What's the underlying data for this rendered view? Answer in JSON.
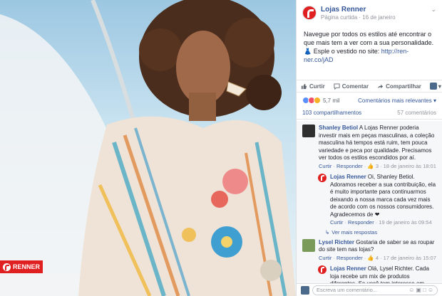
{
  "photo": {
    "badge_text": "RENNER"
  },
  "post": {
    "page_name": "Lojas Renner",
    "page_type": "Página curtida",
    "date": "16 de janeiro",
    "text": "Navegue por todos os estilos até encontrar o que mais tem a ver com a sua personalidade. 👗 Esple o vestido no site: ",
    "link": "http://ren-ner.co/jAD"
  },
  "actions": {
    "like": "Curtir",
    "comment": "Comentar",
    "share": "Compartilhar"
  },
  "reactions": {
    "count": "5,7 mil",
    "sort_label": "Comentários mais relevantes"
  },
  "stats": {
    "shares": "103 compartilhamentos",
    "comments": "57 comentários"
  },
  "comments": [
    {
      "name": "Shanley Betiol",
      "text": "A Lojas Renner poderia investir mais em peças masculinas, a coleção masculina há tempos está ruim, tem pouca variedade e peca por qualidade. Precisamos ver todos os estilos escondidos por aí.",
      "like": "Curtir",
      "reply": "Responder",
      "likes": "3",
      "date": "18 de janeiro às 18:01"
    },
    {
      "name": "Lojas Renner",
      "text": "Oi, Shanley Betiol. Adoramos receber a sua contribuição, ela é muito importante para continuarmos deixando a nossa marca cada vez mais de acordo com os nossos consumidores. Agradecemos de ❤",
      "like": "Curtir",
      "reply": "Responder",
      "date": "19 de janeiro às 09:54"
    },
    {
      "more": "Ver mais respostas"
    },
    {
      "name": "Lysel Richter",
      "text": "Gostaria de saber se as roupar do site tem nas lojas?",
      "like": "Curtir",
      "reply": "Responder",
      "likes": "4",
      "date": "17 de janeiro às 15:07"
    },
    {
      "name": "Lojas Renner",
      "text": "Olá, Lysel Richter. Cada loja recebe um mix de produtos diferentes. Se você tem interesse em algum produto específico, por meio de nosso site é possível saber se a peça..."
    }
  ],
  "compose": {
    "placeholder": "Escreva um comentário..."
  }
}
